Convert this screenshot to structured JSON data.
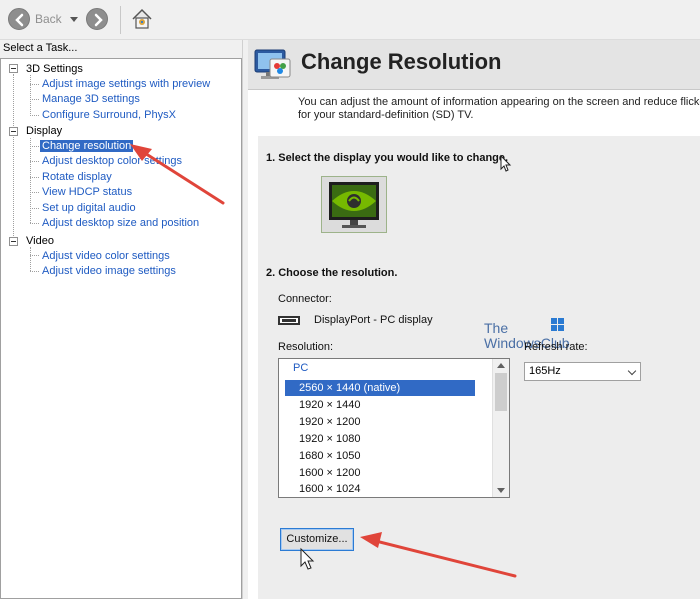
{
  "toolbar": {
    "back_label": "Back"
  },
  "task_panel": {
    "header": "Select a Task...",
    "groups": [
      {
        "label": "3D Settings",
        "items": [
          "Adjust image settings with preview",
          "Manage 3D settings",
          "Configure Surround, PhysX"
        ]
      },
      {
        "label": "Display",
        "items": [
          "Change resolution",
          "Adjust desktop color settings",
          "Rotate display",
          "View HDCP status",
          "Set up digital audio",
          "Adjust desktop size and position"
        ]
      },
      {
        "label": "Video",
        "items": [
          "Adjust video color settings",
          "Adjust video image settings"
        ]
      }
    ],
    "selected_item": "Change resolution"
  },
  "page": {
    "title": "Change Resolution",
    "description_line1": "You can adjust the amount of information appearing on the screen and reduce flickering.",
    "description_line2": "for your standard-definition (SD) TV.",
    "step1": "1. Select the display you would like to change.",
    "step2": "2. Choose the resolution.",
    "connector_label": "Connector:",
    "connector_value": "DisplayPort - PC display",
    "resolution_label": "Resolution:",
    "refresh_label": "Refresh rate:",
    "refresh_value": "165Hz",
    "resolution_group": "PC",
    "resolutions": [
      "2560 × 1440 (native)",
      "1920 × 1440",
      "1920 × 1200",
      "1920 × 1080",
      "1680 × 1050",
      "1600 × 1200",
      "1600 × 1024"
    ],
    "selected_resolution": "2560 × 1440 (native)",
    "customize_label": "Customize..."
  },
  "watermark": {
    "line1": "The",
    "line2": "WindowsClub"
  },
  "colors": {
    "link_blue": "#1f5bc2",
    "selection_blue": "#316ac5",
    "nvidia_green": "#76b900",
    "annotation_red": "#e0453a"
  }
}
